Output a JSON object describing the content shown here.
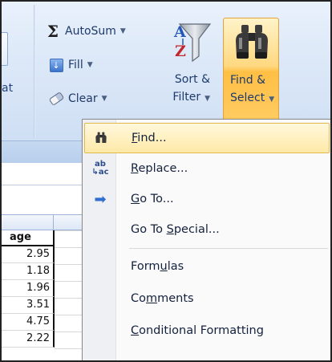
{
  "ribbon": {
    "prev_group_label": "at",
    "autosum_label": "AutoSum",
    "fill_label": "Fill",
    "clear_label": "Clear",
    "sort_filter": {
      "line1": "Sort &",
      "line2": "Filter"
    },
    "find_select": {
      "line1": "Find &",
      "line2": "Select"
    },
    "icons": {
      "autosum": "sigma-icon",
      "fill": "fill-down-icon",
      "clear": "eraser-icon",
      "sort": "sort-az-funnel-icon",
      "find": "binoculars-icon"
    },
    "colors": {
      "find_highlight": "#ffcf6a",
      "ribbon_bg": "#dde9f8"
    }
  },
  "sheet": {
    "column_header": "age",
    "values": [
      "2.95",
      "1.18",
      "1.96",
      "3.51",
      "4.75",
      "2.22"
    ]
  },
  "menu": {
    "items": [
      {
        "pre": "",
        "key": "F",
        "post": "ind...",
        "icon": "binoculars-icon",
        "highlighted": true
      },
      {
        "pre": "",
        "key": "R",
        "post": "eplace...",
        "icon": "replace-icon",
        "highlighted": false
      },
      {
        "pre": "",
        "key": "G",
        "post": "o To...",
        "icon": "go-to-arrow-icon",
        "highlighted": false
      },
      {
        "pre": "Go To ",
        "key": "S",
        "post": "pecial...",
        "icon": "",
        "highlighted": false
      },
      {
        "pre": "Form",
        "key": "u",
        "post": "las",
        "icon": "",
        "highlighted": false
      },
      {
        "pre": "Co",
        "key": "m",
        "post": "ments",
        "icon": "",
        "highlighted": false
      },
      {
        "pre": "",
        "key": "C",
        "post": "onditional Formatting",
        "icon": "",
        "highlighted": false
      }
    ],
    "replace_icon_text": {
      "top": "ab",
      "bottom": "ac"
    }
  }
}
